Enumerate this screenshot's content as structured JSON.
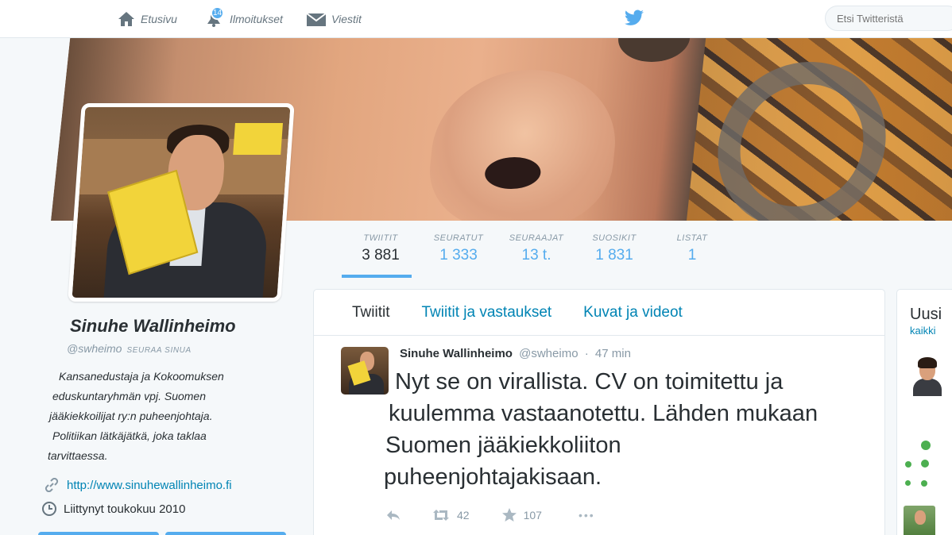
{
  "nav": {
    "home_label": "Etusivu",
    "notifications_label": "Ilmoitukset",
    "notifications_count": "14",
    "messages_label": "Viestit",
    "search_placeholder": "Etsi Twitteristä"
  },
  "stats": [
    {
      "label": "TWIITIT",
      "value": "3 881"
    },
    {
      "label": "SEURATUT",
      "value": "1 333"
    },
    {
      "label": "SEURAAJAT",
      "value": "13 t."
    },
    {
      "label": "SUOSIKIT",
      "value": "1 831"
    },
    {
      "label": "LISTAT",
      "value": "1"
    }
  ],
  "profile": {
    "name": "Sinuhe Wallinheimo",
    "handle": "@swheimo",
    "follows_you": "SEURAA SINUA",
    "bio_lines": [
      "Kansanedustaja ja Kokoomuksen",
      "eduskuntaryhmän vpj. Suomen",
      "jääkiekkoilijat ry:n puheenjohtaja.",
      "Politiikan lätkäjätkä, joka taklaa",
      "tarvittaessa."
    ],
    "url": "http://www.sinuhewallinheimo.fi",
    "joined": "Liittynyt toukokuu 2010"
  },
  "timeline": {
    "tabs": [
      "Twiitit",
      "Twiitit ja vastaukset",
      "Kuvat ja videot"
    ],
    "tweet": {
      "name": "Sinuhe Wallinheimo",
      "handle": "@swheimo",
      "separator": "·",
      "time": "47 min",
      "text_lines": [
        "Nyt se on virallista. CV on toimitettu ja",
        "kuulemma vastaanotettu. Lähden mukaan",
        "Suomen jääkiekkoliiton",
        "puheenjohtajakisaan."
      ],
      "retweets": "42",
      "favorites": "107",
      "more": "•••"
    }
  },
  "right_panel": {
    "title": "Uusi",
    "link": "kaikki"
  },
  "colors": {
    "accent": "#55acee",
    "link": "#0084b4",
    "text": "#292f33",
    "muted": "#8899a6"
  }
}
